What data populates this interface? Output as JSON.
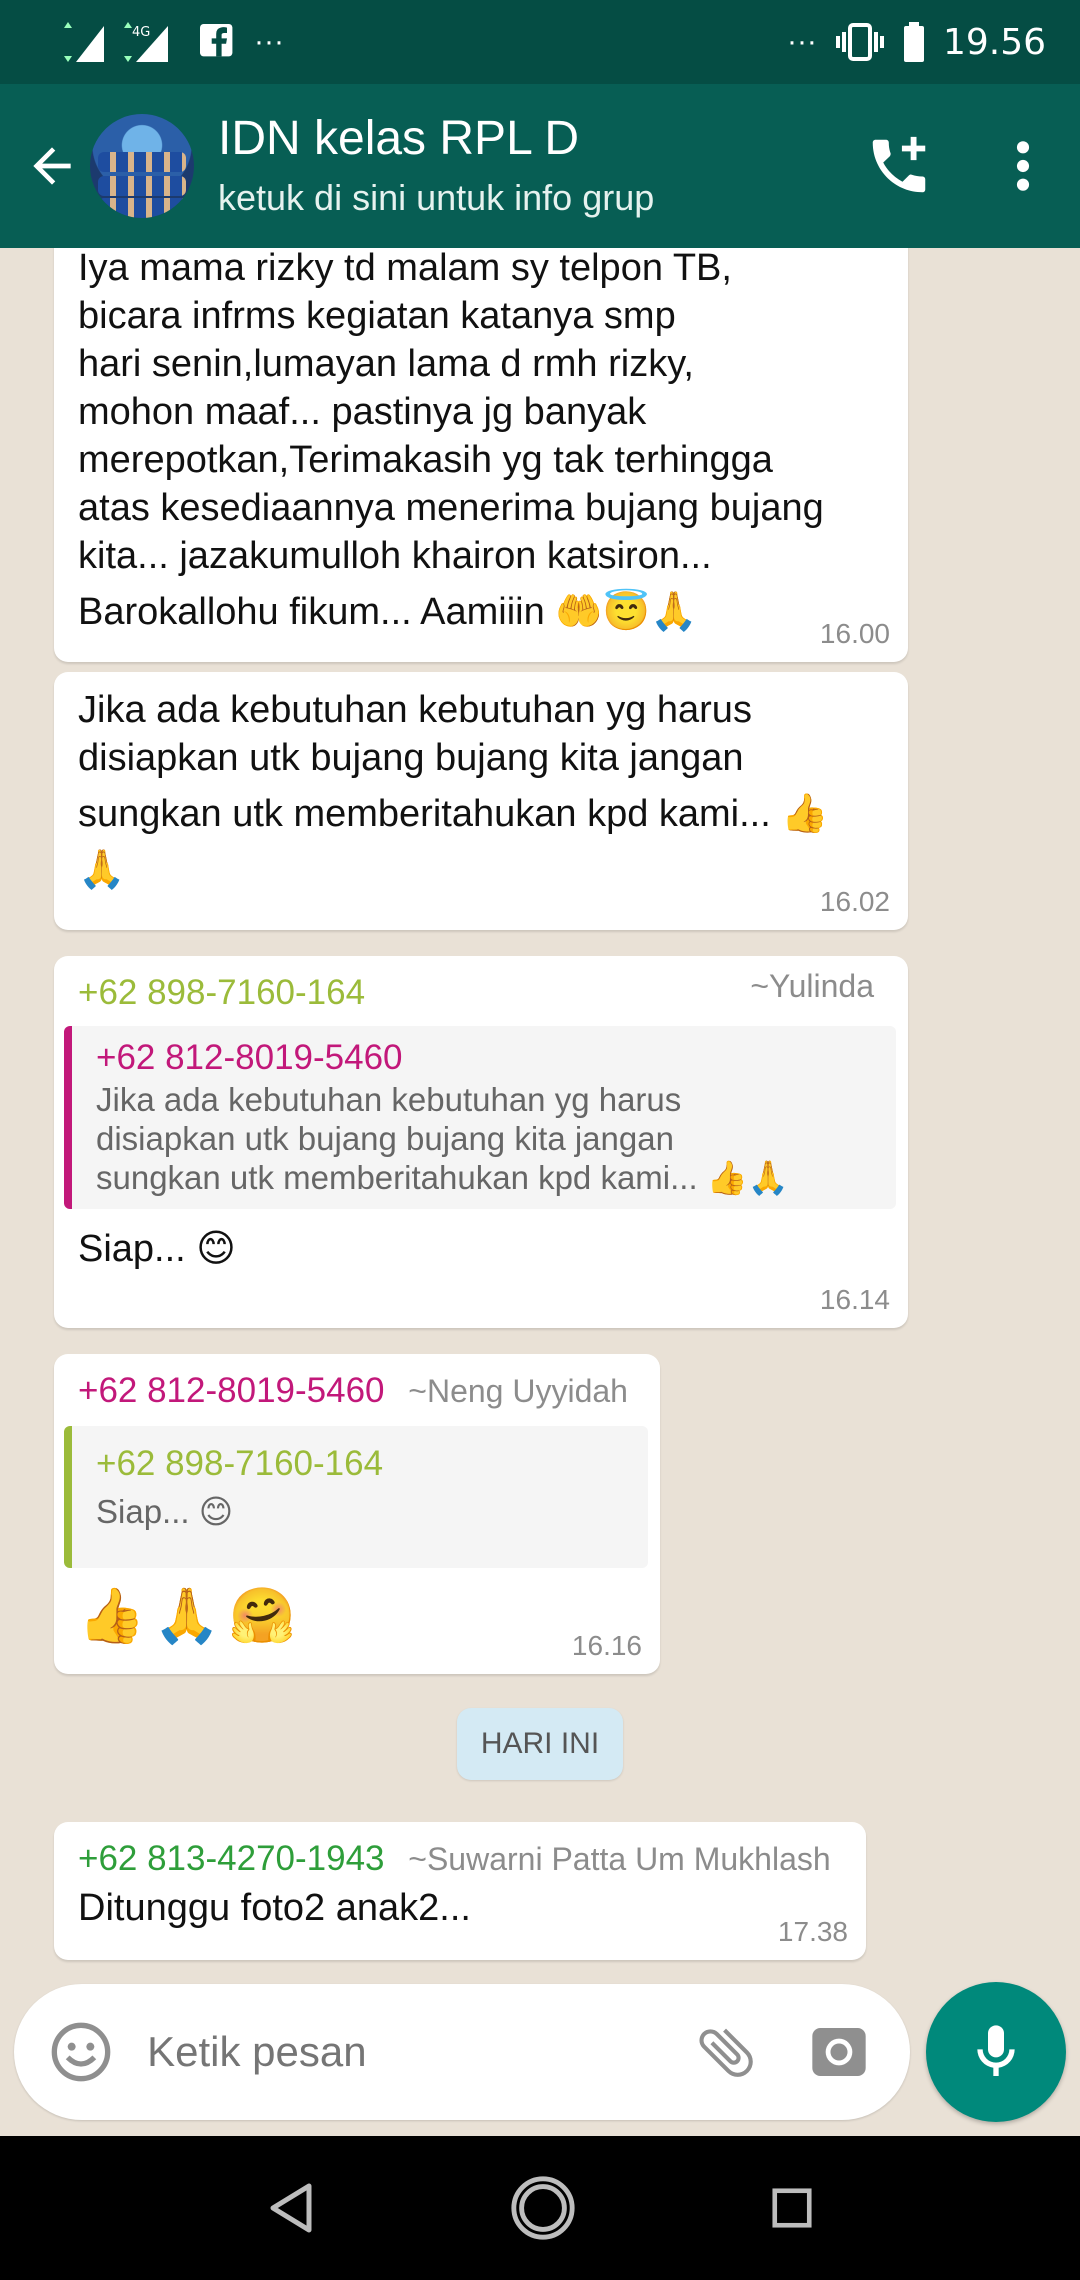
{
  "status_bar": {
    "time": "19.56",
    "network": "4G",
    "app_icon": "facebook-icon",
    "more": "···"
  },
  "header": {
    "title": "IDN kelas RPL D",
    "subtitle": "ketuk di sini untuk info grup"
  },
  "messages": [
    {
      "text_lines": [
        "Iya mama rizky td malam sy telpon TB,",
        "bicara infrms kegiatan katanya smp",
        "hari senin,lumayan lama d rmh rizky,",
        "mohon maaf...  pastinya jg banyak",
        "merepotkan,Terimakasih yg tak terhingga",
        "atas kesediaannya menerima bujang bujang",
        "kita... jazakumulloh khairon katsiron...",
        "Barokallohu fikum... Aamiiin 🤲😇🙏"
      ],
      "time": "16.00"
    },
    {
      "text_lines": [
        "Jika ada kebutuhan kebutuhan yg harus",
        "disiapkan utk bujang bujang kita jangan",
        "sungkan utk memberitahukan kpd kami... 👍",
        "🙏"
      ],
      "time": "16.02"
    },
    {
      "sender": "+62 898-7160-164",
      "alias": "~Yulinda",
      "quote": {
        "sender": "+62 812-8019-5460",
        "lines": [
          "Jika ada kebutuhan kebutuhan yg harus",
          "disiapkan utk bujang bujang kita jangan",
          "sungkan utk memberitahukan kpd kami... 👍🙏"
        ]
      },
      "text": "Siap... 😊",
      "time": "16.14"
    },
    {
      "sender": "+62 812-8019-5460",
      "alias": "~Neng Uyyidah",
      "quote": {
        "sender": "+62 898-7160-164",
        "lines": [
          "Siap... 😊"
        ]
      },
      "text": "👍🙏🤗",
      "time": "16.16"
    },
    {
      "sender": "+62 813-4270-1943",
      "alias": "~Suwarni Patta Um Mukhlash",
      "text": "Ditunggu foto2 anak2...",
      "time": "17.38"
    }
  ],
  "day_divider": "HARI INI",
  "composer": {
    "placeholder": "Ketik pesan"
  },
  "colors": {
    "header": "#075e54",
    "status_bar": "#054d44",
    "sender_green": "#9bbb3a",
    "sender_magenta": "#c2187a",
    "sender_dark_green": "#2e9e3a",
    "mic": "#00897b"
  }
}
